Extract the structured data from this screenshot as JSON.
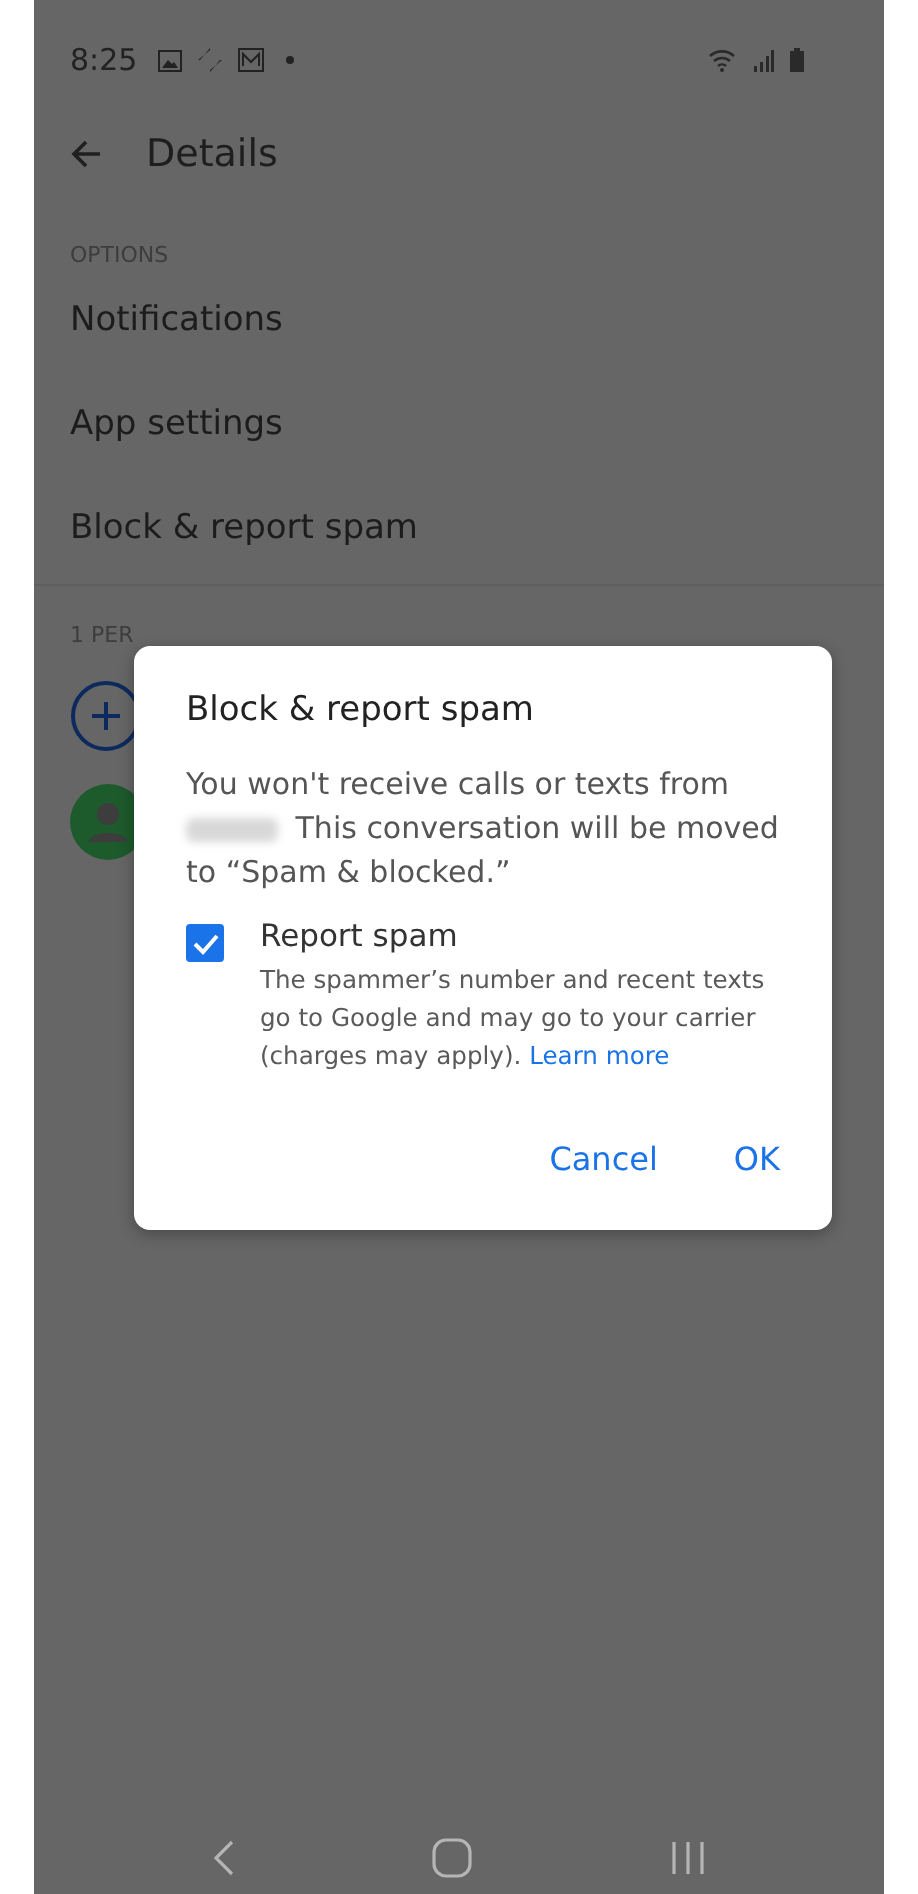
{
  "status_bar": {
    "time": "8:25"
  },
  "app_bar": {
    "title": "Details"
  },
  "section_header": "OPTIONS",
  "options": [
    "Notifications",
    "App settings",
    "Block & report spam"
  ],
  "people_header": "1 PER",
  "dialog": {
    "title": "Block & report spam",
    "body_before": "You won't receive calls or texts from",
    "body_after": "This conversation will be moved to “Spam & blocked.”",
    "checkbox": {
      "label": "Report spam",
      "checked": true,
      "description": "The spammer’s number and recent texts go to Google and may go to your carrier (charges may apply).",
      "link": "Learn more"
    },
    "buttons": [
      "Cancel",
      "OK"
    ]
  }
}
